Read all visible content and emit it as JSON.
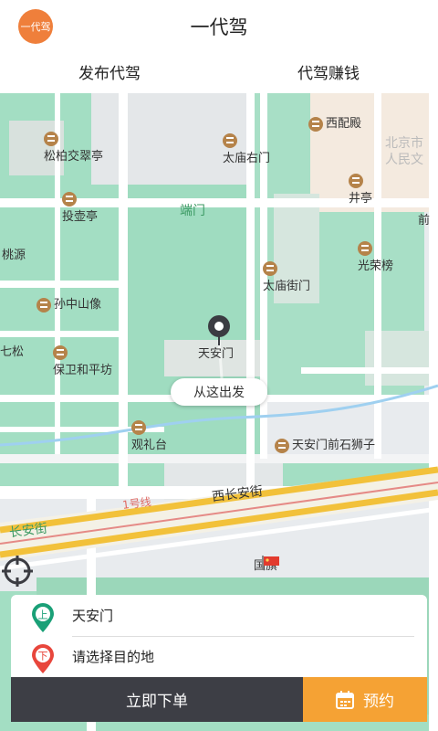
{
  "header": {
    "logo_text": "一代驾",
    "title": "一代驾"
  },
  "tabs": [
    {
      "label": "发布代驾"
    },
    {
      "label": "代驾赚钱"
    }
  ],
  "map": {
    "labels": {
      "xipeidian": "西配殿",
      "beijing": "北京市",
      "renmin": "人民文",
      "songbai": "松柏交翠亭",
      "taimiao_right": "太庙右门",
      "jingting": "井亭",
      "duanmen": "端门",
      "touhu": "投壶亭",
      "qian": "前",
      "taoyuan": "桃源",
      "guangrongbang": "光荣榜",
      "taimiao_street": "太庙街门",
      "sunzhongshan": "孙中山像",
      "qisong": "七松",
      "baowei": "保卫和平坊",
      "tiananmen": "天安门",
      "guanlitai": "观礼台",
      "shishizi": "天安门前石狮子",
      "xichangan": "西长安街",
      "line1": "1号线",
      "changan": "长安街",
      "guoqi": "国旗"
    },
    "start_bubble": "从这出发"
  },
  "icons": {
    "start_pin": "location-pin-icon",
    "locate": "crosshair-locate-icon",
    "calendar": "calendar-icon"
  },
  "route": {
    "start": {
      "badge": "上",
      "value": "天安门"
    },
    "end": {
      "badge": "下",
      "placeholder": "请选择目的地"
    }
  },
  "actions": {
    "order_label": "立即下单",
    "reserve_label": "预约"
  },
  "colors": {
    "brand": "#ef7f3b",
    "start_pin": "#1aa077",
    "end_pin": "#e8463c",
    "order": "#3d3e45",
    "reserve": "#f5a234",
    "park": "#9fdcc0"
  }
}
